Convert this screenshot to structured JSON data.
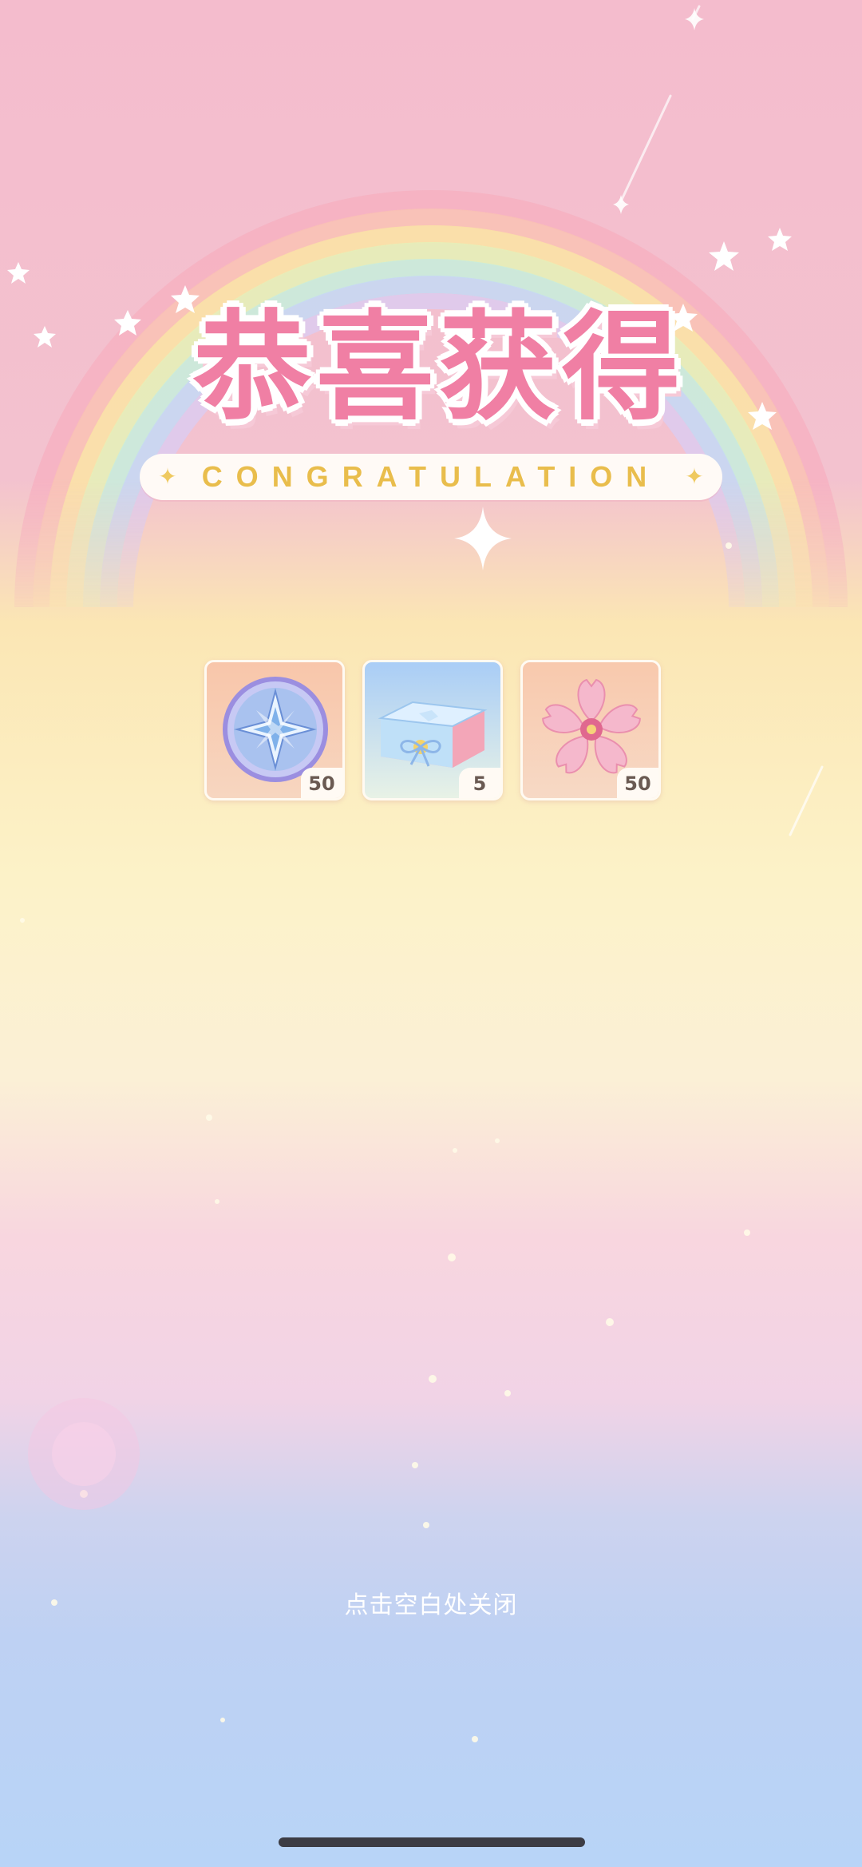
{
  "header": {
    "title": "恭喜获得",
    "subtitle": "CONGRATULATION"
  },
  "rewards": [
    {
      "icon": "compass-star-coin-icon",
      "count": "50"
    },
    {
      "icon": "gift-box-icon",
      "count": "5"
    },
    {
      "icon": "sakura-flower-icon",
      "count": "50"
    }
  ],
  "footer": {
    "close_hint": "点击空白处关闭"
  },
  "colors": {
    "title_pink": "#f07fa4",
    "subtitle_gold": "#e9bd4c",
    "banner_bg": "#fffaf6",
    "home_indicator": "#3c3c44"
  }
}
